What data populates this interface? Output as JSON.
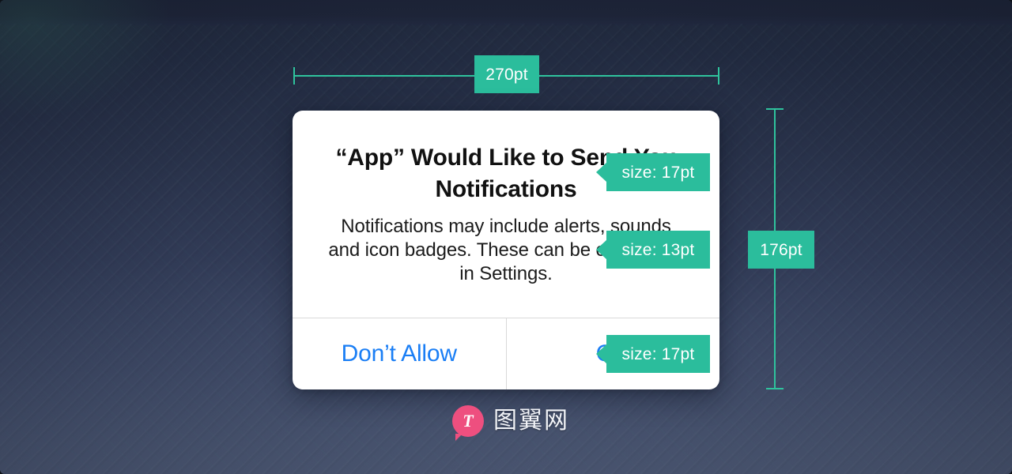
{
  "annotations": {
    "width_label": "270pt",
    "height_label": "176pt",
    "title_size_label": "size: 17pt",
    "body_size_label": "size: 13pt",
    "button_size_label": "size: 17pt",
    "accent_color": "#2bbd9c"
  },
  "dialog": {
    "title": "“App” Would Like to Send You Notifications",
    "message": "Notifications may include alerts, sounds and icon badges. These can be configured in Settings.",
    "buttons": [
      {
        "label": "Don’t Allow"
      },
      {
        "label": "OK"
      }
    ],
    "tint_color": "#1a7ef5",
    "background_color": "#ffffff"
  },
  "watermark": {
    "logo_letter": "T",
    "text": "图翼网",
    "logo_color": "#ee4f7f"
  }
}
